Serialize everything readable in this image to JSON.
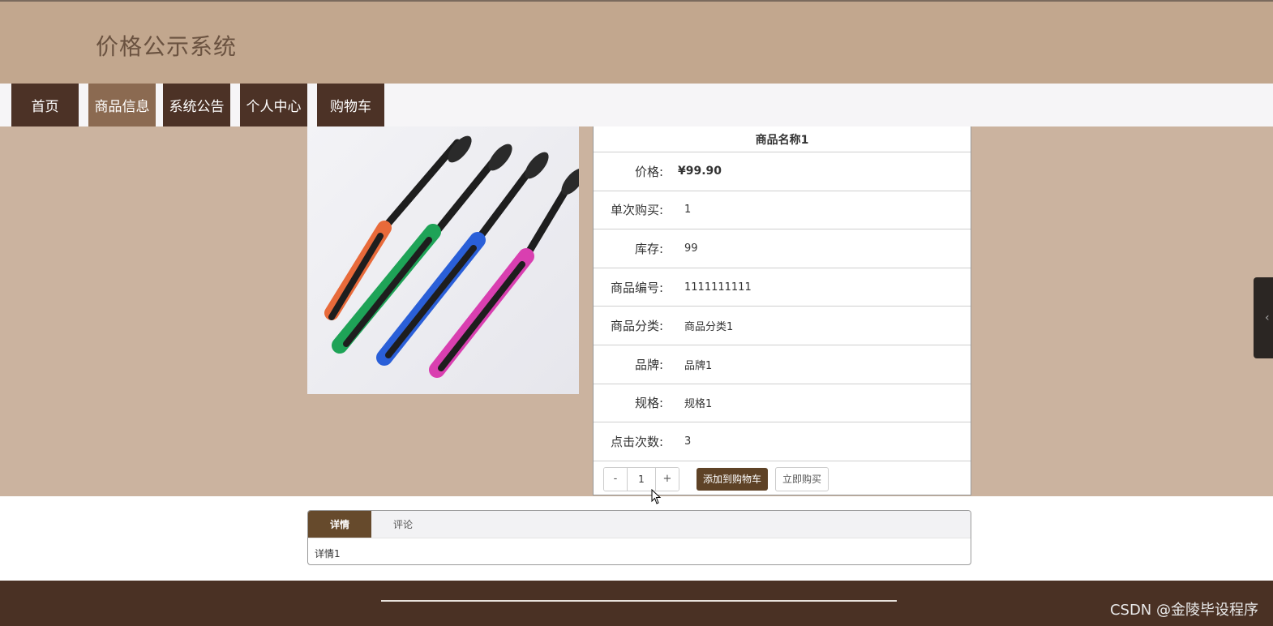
{
  "site": {
    "title": "价格公示系统"
  },
  "nav": {
    "items": [
      {
        "label": "首页",
        "active": false
      },
      {
        "label": "商品信息",
        "active": true
      },
      {
        "label": "系统公告",
        "active": false
      },
      {
        "label": "个人中心",
        "active": false
      },
      {
        "label": "购物车",
        "active": false
      }
    ]
  },
  "product": {
    "name": "商品名称1",
    "price_label": "价格:",
    "price": "¥99.90",
    "fields": [
      {
        "label": "单次购买:",
        "value": "1"
      },
      {
        "label": "库存:",
        "value": "99"
      },
      {
        "label": "商品编号:",
        "value": "1111111111"
      },
      {
        "label": "商品分类:",
        "value": "商品分类1"
      },
      {
        "label": "品牌:",
        "value": "品牌1"
      },
      {
        "label": "规格:",
        "value": "规格1"
      },
      {
        "label": "点击次数:",
        "value": "3"
      }
    ]
  },
  "purchase": {
    "minus_label": "-",
    "quantity": "1",
    "plus_label": "+",
    "add_to_cart_label": "添加到购物车",
    "buy_now_label": "立即购买"
  },
  "tabs": {
    "items": [
      {
        "label": "详情",
        "active": true
      },
      {
        "label": "评论",
        "active": false
      }
    ],
    "content": "详情1"
  },
  "footer": {
    "watermark": "CSDN @金陵毕设程序"
  },
  "colors": {
    "header_bg": "#c2a78e",
    "nav_bg": "#4c3226",
    "nav_active_bg": "#8b6a51",
    "content_bg": "#cbb39f",
    "footer_bg": "#4a3124",
    "cart_button_bg": "#5e4226"
  }
}
